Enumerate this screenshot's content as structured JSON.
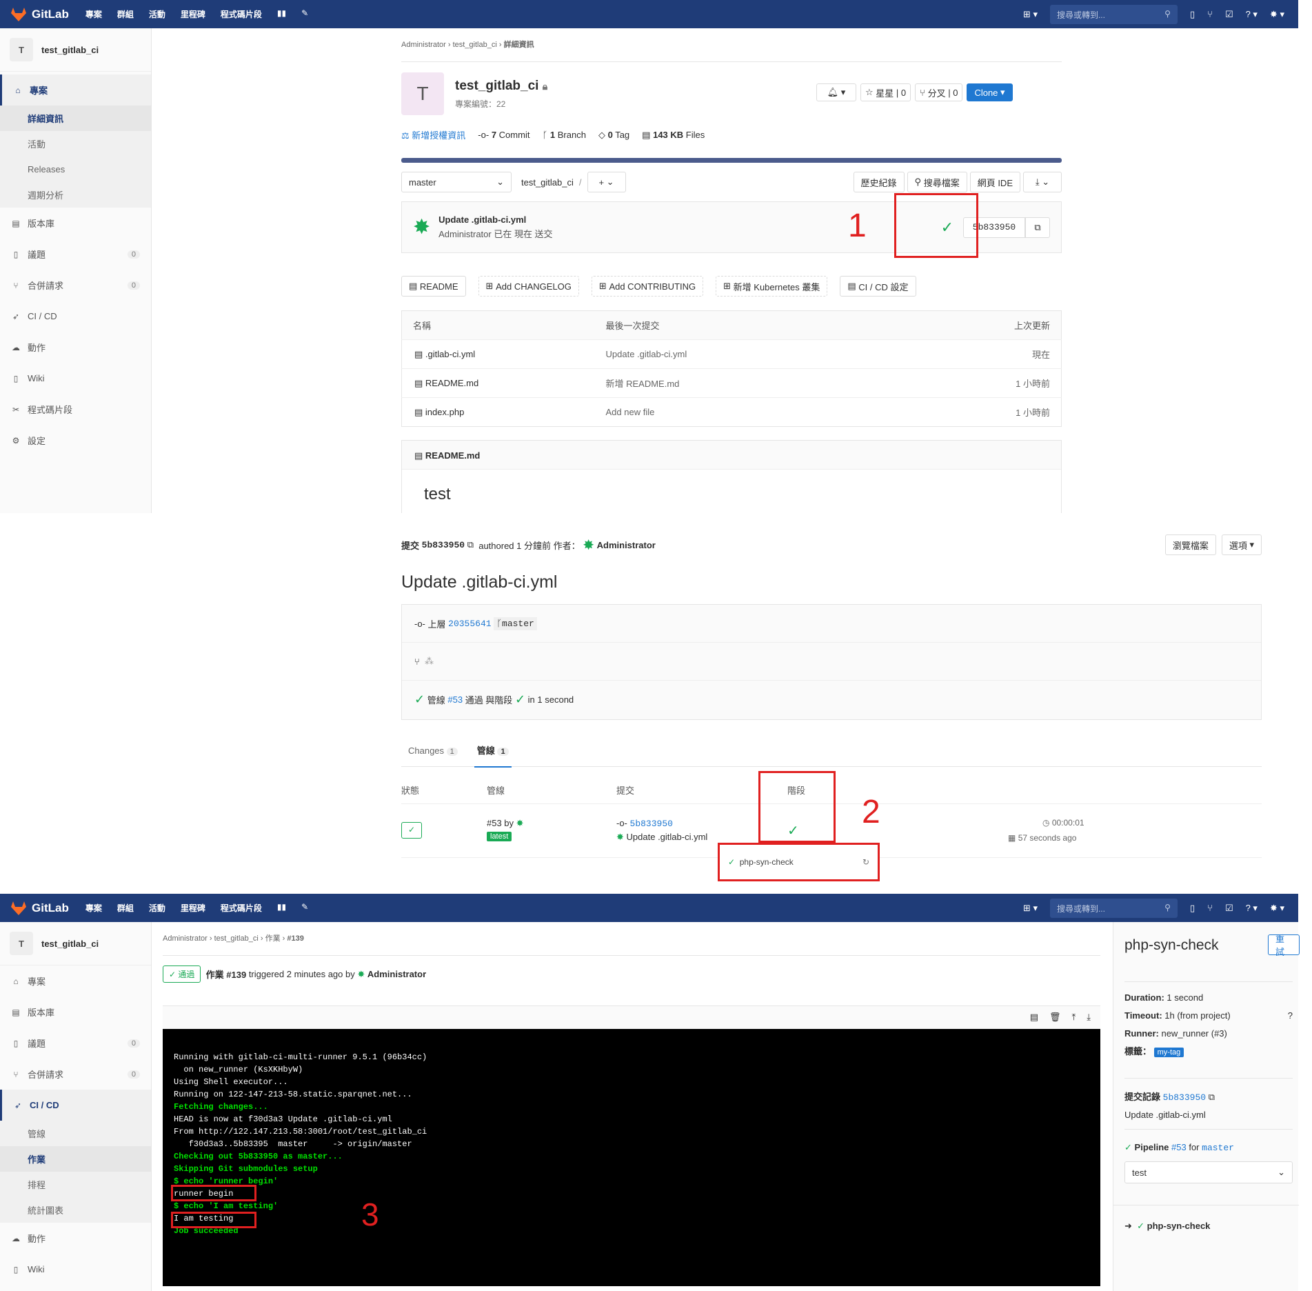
{
  "nav": {
    "brand": "GitLab",
    "menu": [
      "專案",
      "群組",
      "活動",
      "里程碑",
      "程式碼片段"
    ],
    "search_placeholder": "搜尋或轉到..."
  },
  "project": {
    "name": "test_gitlab_ci",
    "avatar": "T",
    "id_text": "專案編號：22"
  },
  "sidebar1": {
    "items": [
      {
        "label": "專案",
        "icon": "home-icon"
      },
      {
        "label": "版本庫",
        "icon": "doc-icon"
      },
      {
        "label": "議題",
        "icon": "issues-icon",
        "count": "0"
      },
      {
        "label": "合併請求",
        "icon": "merge-icon",
        "count": "0"
      },
      {
        "label": "CI / CD",
        "icon": "rocket-icon"
      },
      {
        "label": "動作",
        "icon": "cloud-icon"
      },
      {
        "label": "Wiki",
        "icon": "book-icon"
      },
      {
        "label": "程式碼片段",
        "icon": "scissors-icon"
      },
      {
        "label": "設定",
        "icon": "gear-icon"
      }
    ],
    "sub": [
      "詳細資訊",
      "活動",
      "Releases",
      "週期分析"
    ]
  },
  "breadcrumb1": [
    "Administrator",
    "test_gitlab_ci",
    "詳細資訊"
  ],
  "proj_actions": {
    "star": "星星",
    "star_count": "0",
    "fork": "分叉",
    "fork_count": "0",
    "clone": "Clone"
  },
  "stats": {
    "license": "新增授權資訊",
    "commits": "7",
    "commits_label": "Commit",
    "branches": "1",
    "branches_label": "Branch",
    "tags": "0",
    "tags_label": "Tag",
    "size": "143 KB",
    "size_label": "Files"
  },
  "repo_bar": {
    "branch": "master",
    "path": "test_gitlab_ci",
    "add": "+",
    "history": "歷史紀錄",
    "find": "搜尋檔案",
    "ide": "網頁 IDE"
  },
  "last_commit": {
    "title": "Update .gitlab-ci.yml",
    "meta": "Administrator 已在 現在 送交",
    "sha": "5b833950"
  },
  "quick_buttons": [
    "README",
    "Add CHANGELOG",
    "Add CONTRIBUTING",
    "新增 Kubernetes 叢集",
    "CI / CD 設定"
  ],
  "file_table": {
    "headers": [
      "名稱",
      "最後一次提交",
      "上次更新"
    ],
    "rows": [
      {
        "name": ".gitlab-ci.yml",
        "commit": "Update .gitlab-ci.yml",
        "time": "現在"
      },
      {
        "name": "README.md",
        "commit": "新增 README.md",
        "time": "1 小時前"
      },
      {
        "name": "index.php",
        "commit": "Add new file",
        "time": "1 小時前"
      }
    ]
  },
  "readme": {
    "file": "README.md",
    "content": "test"
  },
  "commit_page": {
    "label": "提交",
    "sha": "5b833950",
    "authored": "authored 1 分鐘前 作者：",
    "author": "Administrator",
    "browse": "瀏覽檔案",
    "options": "選項",
    "title": "Update .gitlab-ci.yml",
    "parent_label": "上層",
    "parent_sha": "20355641",
    "branch": "master",
    "pipeline_pre": "管線",
    "pipeline_id": "#53",
    "pipeline_mid": "通過 與階段",
    "pipeline_post": "in 1 second",
    "tab_changes": "Changes",
    "tab_changes_count": "1",
    "tab_pipelines": "管線",
    "tab_pipelines_count": "1"
  },
  "pipe_table": {
    "headers": [
      "狀態",
      "管線",
      "提交",
      "階段"
    ],
    "pipeline": "#53 by",
    "latest": "latest",
    "sha": "5b833950",
    "commit": "Update .gitlab-ci.yml",
    "duration": "00:00:01",
    "ago": "57 seconds ago",
    "job": "php-syn-check"
  },
  "annotations": [
    "1",
    "2",
    "3"
  ],
  "sidebar2": {
    "items": [
      {
        "label": "專案",
        "icon": "home-icon"
      },
      {
        "label": "版本庫",
        "icon": "doc-icon"
      },
      {
        "label": "議題",
        "icon": "issues-icon",
        "count": "0"
      },
      {
        "label": "合併請求",
        "icon": "merge-icon",
        "count": "0"
      },
      {
        "label": "CI / CD",
        "icon": "rocket-icon"
      },
      {
        "label": "動作",
        "icon": "cloud-icon"
      },
      {
        "label": "Wiki",
        "icon": "book-icon"
      }
    ],
    "sub": [
      "管線",
      "作業",
      "排程",
      "統計圖表"
    ]
  },
  "breadcrumb2": [
    "Administrator",
    "test_gitlab_ci",
    "作業",
    "#139"
  ],
  "job": {
    "status": "通過",
    "title": "作業 #139",
    "triggered": "triggered 2 minutes ago by",
    "user": "Administrator"
  },
  "terminal": [
    {
      "t": "Running with gitlab-ci-multi-runner 9.5.1 (96b34cc)",
      "g": false
    },
    {
      "t": "  on new_runner (KsXKHbyW)",
      "g": false
    },
    {
      "t": "Using Shell executor...",
      "g": false
    },
    {
      "t": "Running on 122-147-213-58.static.sparqnet.net...",
      "g": false
    },
    {
      "t": "Fetching changes...",
      "g": true
    },
    {
      "t": "HEAD is now at f30d3a3 Update .gitlab-ci.yml",
      "g": false
    },
    {
      "t": "From http://122.147.213.58:3001/root/test_gitlab_ci",
      "g": false
    },
    {
      "t": "   f30d3a3..5b83395  master     -> origin/master",
      "g": false
    },
    {
      "t": "Checking out 5b833950 as master...",
      "g": true
    },
    {
      "t": "Skipping Git submodules setup",
      "g": true
    },
    {
      "t": "$ echo 'runner begin'",
      "g": true
    },
    {
      "t": "runner begin",
      "g": false
    },
    {
      "t": "$ echo 'I am testing'",
      "g": true
    },
    {
      "t": "I am testing",
      "g": false
    },
    {
      "t": "Job succeeded",
      "g": true
    }
  ],
  "right_panel": {
    "title": "php-syn-check",
    "retry": "重試",
    "duration_l": "Duration:",
    "duration_v": "1 second",
    "timeout_l": "Timeout:",
    "timeout_v": "1h (from project)",
    "runner_l": "Runner:",
    "runner_v": "new_runner (#3)",
    "tags_l": "標籤：",
    "tag": "my-tag",
    "commit_l": "提交記錄",
    "commit_sha": "5b833950",
    "commit_title": "Update .gitlab-ci.yml",
    "pipeline_l": "Pipeline",
    "pipeline_id": "#53",
    "pipeline_for": "for",
    "pipeline_branch": "master",
    "stage": "test",
    "job": "php-syn-check"
  }
}
